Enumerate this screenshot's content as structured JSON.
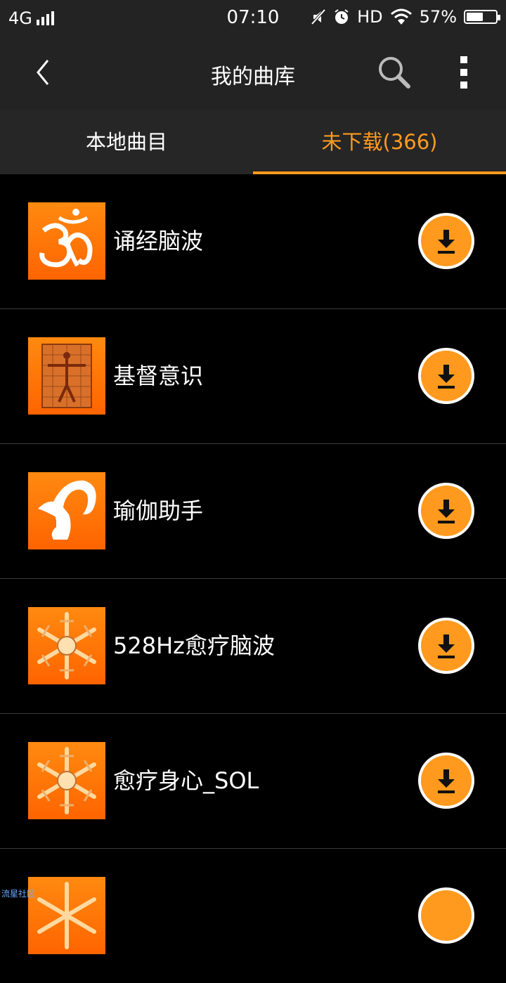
{
  "status_bar": {
    "network": "4G",
    "time": "07:10",
    "hd": "HD",
    "battery": "57%",
    "battery_level": 0.57
  },
  "header": {
    "title": "我的曲库"
  },
  "tabs": [
    {
      "label": "本地曲目"
    },
    {
      "label": "未下载(366)"
    }
  ],
  "list": [
    {
      "title": "诵经脑波",
      "thumb_icon": "om-symbol"
    },
    {
      "title": "基督意识",
      "thumb_icon": "vitruvian-man"
    },
    {
      "title": "瑜伽助手",
      "thumb_icon": "yoga-pose"
    },
    {
      "title": "528Hz愈疗脑波",
      "thumb_icon": "snowflake"
    },
    {
      "title": "愈疗身心_SOL",
      "thumb_icon": "snowflake"
    }
  ],
  "watermark": "流星社区",
  "colors": {
    "accent": "#ff9a1f",
    "bar": "#232323",
    "background": "#000000"
  }
}
